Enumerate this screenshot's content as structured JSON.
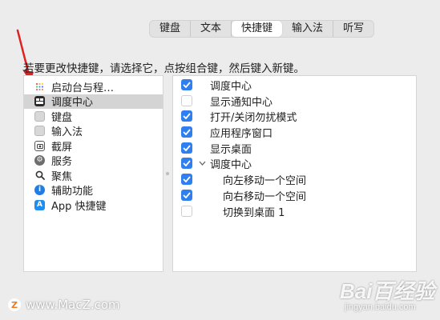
{
  "tabs": [
    {
      "label": "键盘",
      "active": false
    },
    {
      "label": "文本",
      "active": false
    },
    {
      "label": "快捷键",
      "active": true
    },
    {
      "label": "输入法",
      "active": false
    },
    {
      "label": "听写",
      "active": false
    }
  ],
  "instruction": "若要更改快捷键，请选择它，点按组合键，然后键入新键。",
  "categories": [
    {
      "label": "启动台与程…",
      "icon": "launchpad-icon"
    },
    {
      "label": "调度中心",
      "icon": "mission-control-icon",
      "selected": true
    },
    {
      "label": "键盘",
      "icon": "keyboard-icon"
    },
    {
      "label": "输入法",
      "icon": "input-method-icon"
    },
    {
      "label": "截屏",
      "icon": "screenshot-icon"
    },
    {
      "label": "服务",
      "icon": "services-gear-icon"
    },
    {
      "label": "聚焦",
      "icon": "spotlight-icon"
    },
    {
      "label": "辅助功能",
      "icon": "accessibility-icon"
    },
    {
      "label": "App 快捷键",
      "icon": "app-store-icon"
    }
  ],
  "shortcuts": [
    {
      "label": "调度中心",
      "checked": true
    },
    {
      "label": "显示通知中心",
      "checked": false
    },
    {
      "label": "打开/关闭勿扰模式",
      "checked": true
    },
    {
      "label": "应用程序窗口",
      "checked": true
    },
    {
      "label": "显示桌面",
      "checked": true
    },
    {
      "label": "调度中心",
      "checked": true,
      "expanded": true
    },
    {
      "label": "向左移动一个空间",
      "checked": true,
      "indented": true
    },
    {
      "label": "向右移动一个空间",
      "checked": true,
      "indented": true
    },
    {
      "label": "切换到桌面 1",
      "checked": false,
      "indented": true
    }
  ],
  "watermark": {
    "text": "www.MacZ.com",
    "logo": "Z"
  },
  "baidu": {
    "main": "Bai百经验",
    "sub": "jingyan.baidu.com"
  },
  "colors": {
    "accent": "#2f7ff1",
    "selection": "#d4d4d4",
    "arrow": "#e02020"
  }
}
